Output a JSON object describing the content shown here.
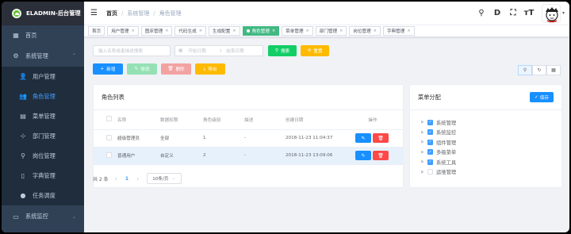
{
  "app": {
    "title": "ELADMIN-后台管理"
  },
  "sidebar": {
    "items": [
      {
        "label": "首页",
        "icon": "dashboard-icon"
      },
      {
        "label": "系统管理",
        "icon": "system-icon"
      },
      {
        "label": "用户管理",
        "icon": "user-icon"
      },
      {
        "label": "角色管理",
        "icon": "role-icon"
      },
      {
        "label": "菜单管理",
        "icon": "menu-icon"
      },
      {
        "label": "部门管理",
        "icon": "dept-icon"
      },
      {
        "label": "岗位管理",
        "icon": "job-icon"
      },
      {
        "label": "字典管理",
        "icon": "dict-icon"
      },
      {
        "label": "任务调度",
        "icon": "timing-icon"
      },
      {
        "label": "系统监控",
        "icon": "monitor-icon"
      }
    ]
  },
  "breadcrumb": {
    "home": "首页",
    "level1": "系统管理",
    "level2": "角色管理"
  },
  "tags": [
    {
      "label": "首页",
      "active": false
    },
    {
      "label": "用户管理",
      "active": false
    },
    {
      "label": "图床管理",
      "active": false
    },
    {
      "label": "代码生成",
      "active": false
    },
    {
      "label": "生成配置",
      "active": false
    },
    {
      "label": "角色管理",
      "active": true
    },
    {
      "label": "菜单管理",
      "active": false
    },
    {
      "label": "部门管理",
      "active": false
    },
    {
      "label": "岗位管理",
      "active": false
    },
    {
      "label": "字典管理",
      "active": false
    }
  ],
  "filters": {
    "search_placeholder": "输入名称或者描述搜索",
    "start_placeholder": "开始日期",
    "range_sep": ":",
    "end_placeholder": "结束日期",
    "search_btn": "搜索",
    "reset_btn": "重置"
  },
  "actions": {
    "add": "新增",
    "edit": "修改",
    "delete": "删除",
    "export": "导出"
  },
  "roles": {
    "title": "角色列表",
    "columns": [
      "名称",
      "数据权限",
      "角色级别",
      "描述",
      "创建日期",
      "操作"
    ],
    "rows": [
      {
        "name": "超级管理员",
        "scope": "全部",
        "level": "1",
        "desc": "-",
        "created": "2018-11-23 11:04:37"
      },
      {
        "name": "普通用户",
        "scope": "自定义",
        "level": "2",
        "desc": "-",
        "created": "2018-11-23 13:09:06"
      }
    ],
    "pager": {
      "total": "共 2 条",
      "page": "1",
      "prev": "‹",
      "next": "›",
      "size": "10条/页"
    }
  },
  "menu_assign": {
    "title": "菜单分配",
    "save": "保存",
    "tree": [
      {
        "label": "系统管理",
        "checked": true
      },
      {
        "label": "系统监控",
        "checked": true
      },
      {
        "label": "组件管理",
        "checked": true
      },
      {
        "label": "多级菜单",
        "checked": true
      },
      {
        "label": "系统工具",
        "checked": true
      },
      {
        "label": "运维管理",
        "checked": false
      }
    ]
  },
  "colors": {
    "primary": "#1890ff",
    "accent_green": "#42b983",
    "sidebar_bg": "#304156",
    "danger": "#ff4949"
  }
}
